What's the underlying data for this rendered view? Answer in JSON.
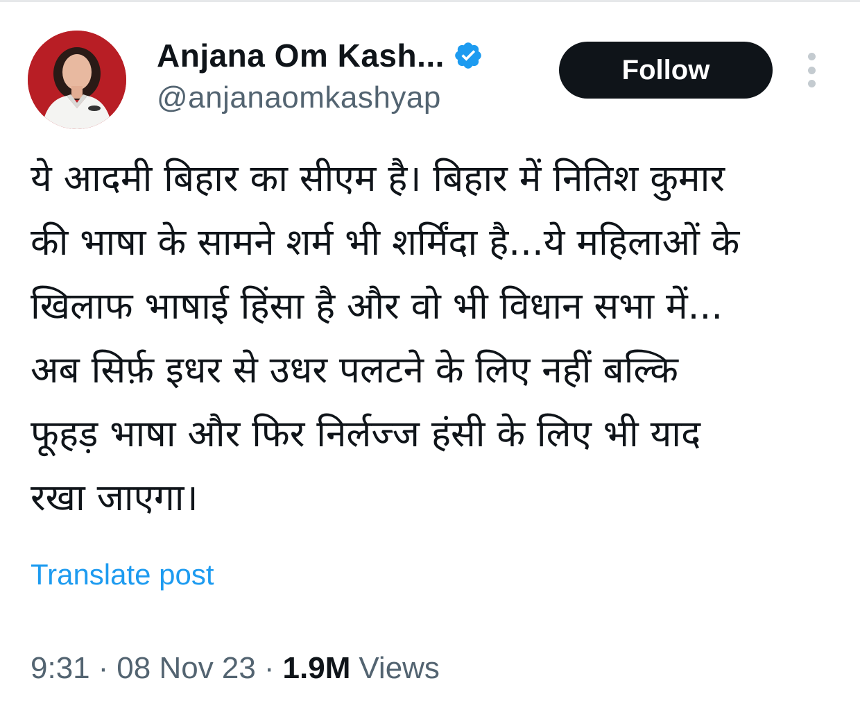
{
  "author": {
    "display_name": "Anjana Om Kash...",
    "handle": "@anjanaomkashyap",
    "verified": true,
    "verified_color": "#1d9bf0"
  },
  "actions": {
    "follow_label": "Follow",
    "more_icon": "more-vertical-icon"
  },
  "tweet": {
    "lines": [
      "ये आदमी बिहार का सीएम है। बिहार में नितिश कुमार",
      "की भाषा के सामने शर्म भी शर्मिंदा है...ये महिलाओं के",
      "खिलाफ भाषाई हिंसा है और वो भी विधान सभा में...",
      "अब सिर्फ़ इधर से उधर पलटने के लिए नहीं बल्कि",
      "फूहड़ भाषा और फिर निर्लज्ज हंसी के लिए भी याद",
      "रखा जाएगा।"
    ],
    "translate_label": "Translate post"
  },
  "meta": {
    "time": "9:31",
    "separator": "·",
    "date": "08 Nov 23",
    "views_count": "1.9M",
    "views_label": "Views"
  },
  "colors": {
    "link": "#1d9bf0",
    "secondary_text": "#536471",
    "primary_text": "#0f1419",
    "follow_bg": "#0f1419"
  }
}
